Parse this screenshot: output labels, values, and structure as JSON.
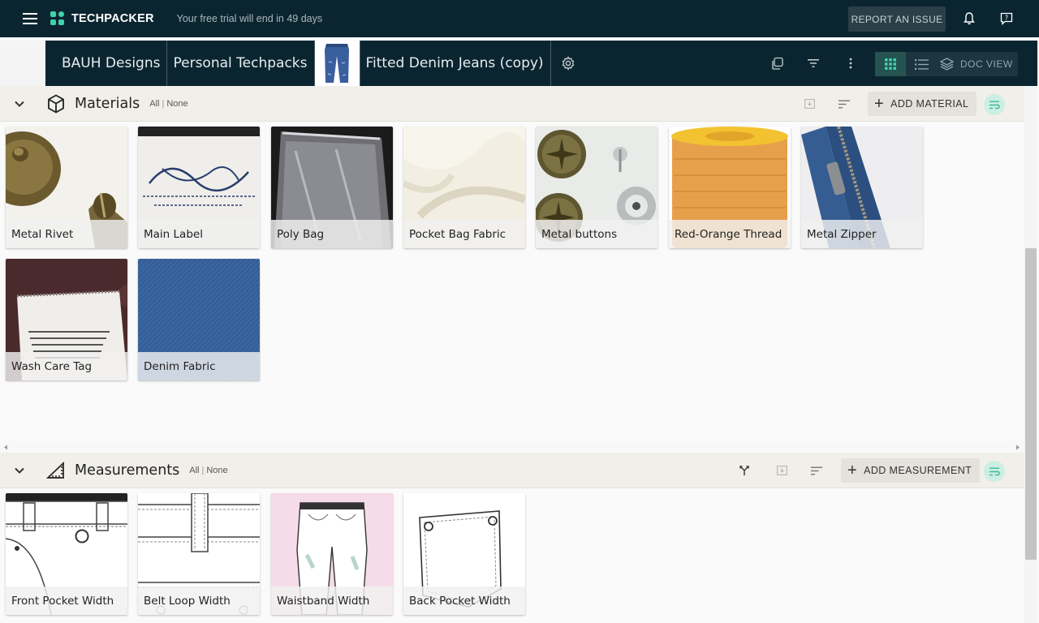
{
  "app": {
    "brand": "TECHPACKER",
    "trial_text": "Your free trial will end in 49 days",
    "report_label": "REPORT AN ISSUE"
  },
  "breadcrumb": {
    "items": [
      "BAUH Designs",
      "Personal Techpacks",
      "Fitted Denim Jeans (copy)"
    ]
  },
  "view": {
    "doc_view_label": "DOC VIEW",
    "active": "grid"
  },
  "materials": {
    "title": "Materials",
    "all_label": "All",
    "none_label": "None",
    "separator": "|",
    "add_label": "ADD MATERIAL",
    "items": [
      {
        "label": "Metal Rivet"
      },
      {
        "label": "Main Label"
      },
      {
        "label": "Poly Bag"
      },
      {
        "label": "Pocket Bag Fabric"
      },
      {
        "label": "Metal buttons"
      },
      {
        "label": "Red-Orange Thread"
      },
      {
        "label": "Metal Zipper"
      },
      {
        "label": "Wash Care Tag"
      },
      {
        "label": "Denim Fabric"
      }
    ]
  },
  "measurements": {
    "title": "Measurements",
    "all_label": "All",
    "none_label": "None",
    "separator": "|",
    "add_label": "ADD MEASUREMENT",
    "items": [
      {
        "label": "Front Pocket Width"
      },
      {
        "label": "Belt Loop Width"
      },
      {
        "label": "Waistband Width"
      },
      {
        "label": "Back Pocket Width"
      }
    ]
  },
  "colors": {
    "topbar": "#0b2530",
    "accent": "#41d1ad",
    "section_header": "#f1efe9"
  }
}
